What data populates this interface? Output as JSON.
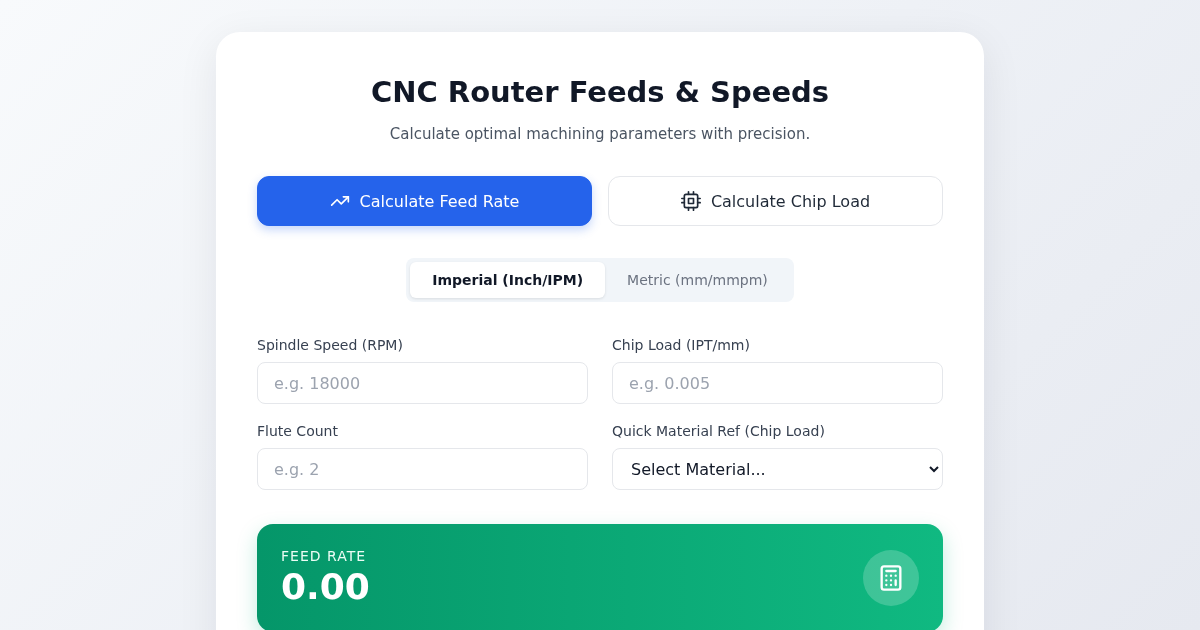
{
  "header": {
    "title": "CNC Router Feeds & Speeds",
    "subtitle": "Calculate optimal machining parameters with precision."
  },
  "modes": [
    {
      "label": "Calculate Feed Rate",
      "kind": "trend",
      "selected": true
    },
    {
      "label": "Calculate Chip Load",
      "kind": "chip",
      "selected": false
    }
  ],
  "units": [
    {
      "label": "Imperial (Inch/IPM)",
      "selected": true
    },
    {
      "label": "Metric (mm/mmpm)",
      "selected": false
    }
  ],
  "fields": [
    {
      "kind": "input",
      "label": "Spindle Speed (RPM)",
      "placeholder": "e.g. 18000"
    },
    {
      "kind": "input",
      "label": "Chip Load (IPT/mm)",
      "placeholder": "e.g. 0.005"
    },
    {
      "kind": "input",
      "label": "Flute Count",
      "placeholder": "e.g. 2"
    },
    {
      "kind": "select",
      "label": "Quick Material Ref (Chip Load)",
      "value": "Select Material..."
    }
  ],
  "result": {
    "label": "FEED RATE",
    "value": "0.00"
  }
}
